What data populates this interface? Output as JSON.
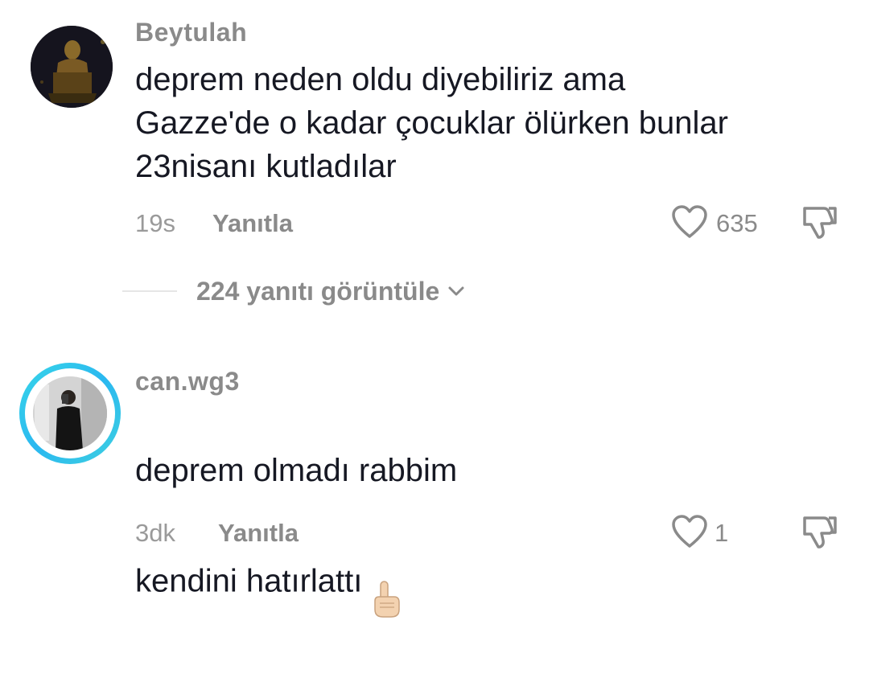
{
  "comments": [
    {
      "username": "Beytulah",
      "text": "deprem neden oldu diyebiliriz ama\nGazze'de o kadar çocuklar ölürken bunlar\n23nisanı kutladılar",
      "time": "19s",
      "reply_label": "Yanıtla",
      "likes": "635",
      "view_replies_label": "224 yanıtı görüntüle"
    },
    {
      "username": "can.wg3",
      "text_line1": "deprem olmadı rabbim",
      "text_line2": "kendini hatırlattı",
      "emoji": "☝🏻",
      "time": "3dk",
      "reply_label": "Yanıtla",
      "likes": "1"
    }
  ],
  "icons": {
    "like": "heart-outline-icon",
    "dislike": "thumbs-down-outline-icon",
    "chevron": "chevron-down-icon",
    "story_ring": "#38d6e8"
  }
}
